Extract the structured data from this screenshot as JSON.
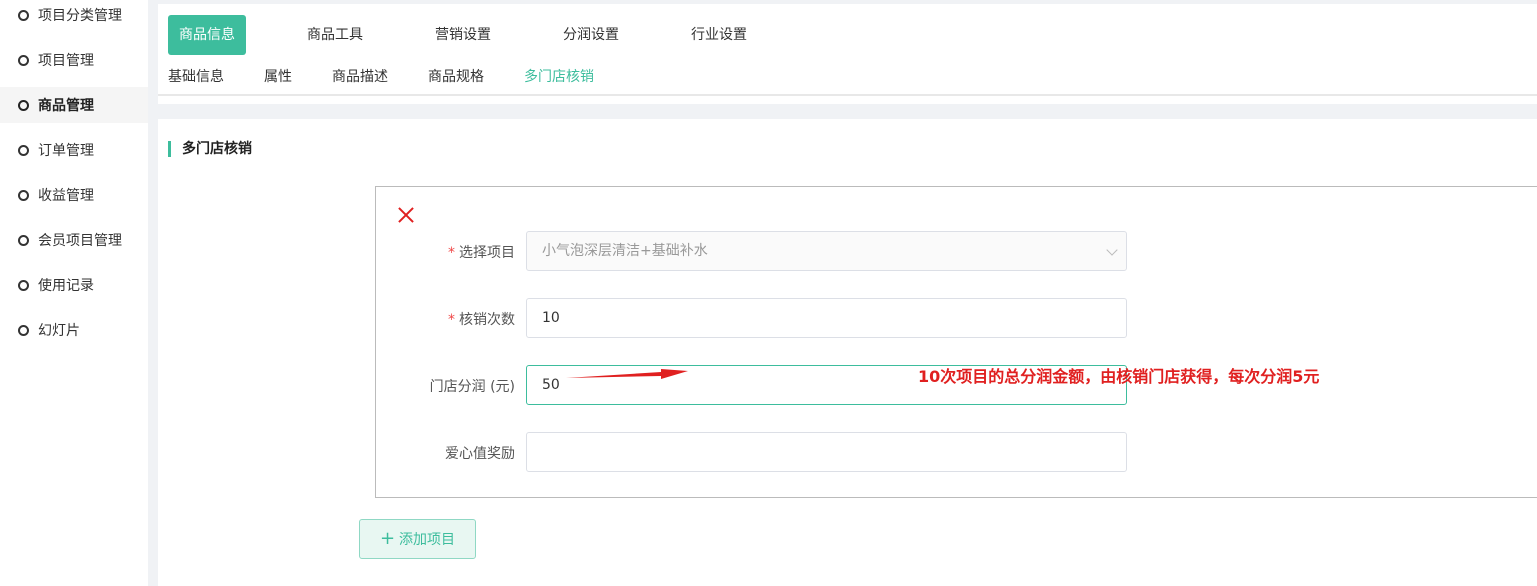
{
  "sidebar": {
    "items": [
      {
        "label": "项目分类管理",
        "active": false
      },
      {
        "label": "项目管理",
        "active": false
      },
      {
        "label": "商品管理",
        "active": true
      },
      {
        "label": "订单管理",
        "active": false
      },
      {
        "label": "收益管理",
        "active": false
      },
      {
        "label": "会员项目管理",
        "active": false
      },
      {
        "label": "使用记录",
        "active": false
      },
      {
        "label": "幻灯片",
        "active": false
      }
    ]
  },
  "main_tabs": [
    "商品信息",
    "商品工具",
    "营销设置",
    "分润设置",
    "行业设置"
  ],
  "main_tab_active": "商品信息",
  "sub_tabs": [
    "基础信息",
    "属性",
    "商品描述",
    "商品规格",
    "多门店核销"
  ],
  "sub_tab_active": "多门店核销",
  "section_title": "多门店核销",
  "form": {
    "project_label": "选择项目",
    "project_value": "小气泡深层清洁+基础补水",
    "count_label": "核销次数",
    "count_value": "10",
    "profit_label": "门店分润 (元)",
    "profit_value": "50",
    "reward_label": "爱心值奖励",
    "reward_value": ""
  },
  "annotation": "10次项目的总分润金额，由核销门店获得，每次分润5元",
  "add_button_label": "添加项目",
  "colors": {
    "accent": "#3dbd9d",
    "annotation": "#e02020",
    "required": "#f04848"
  }
}
